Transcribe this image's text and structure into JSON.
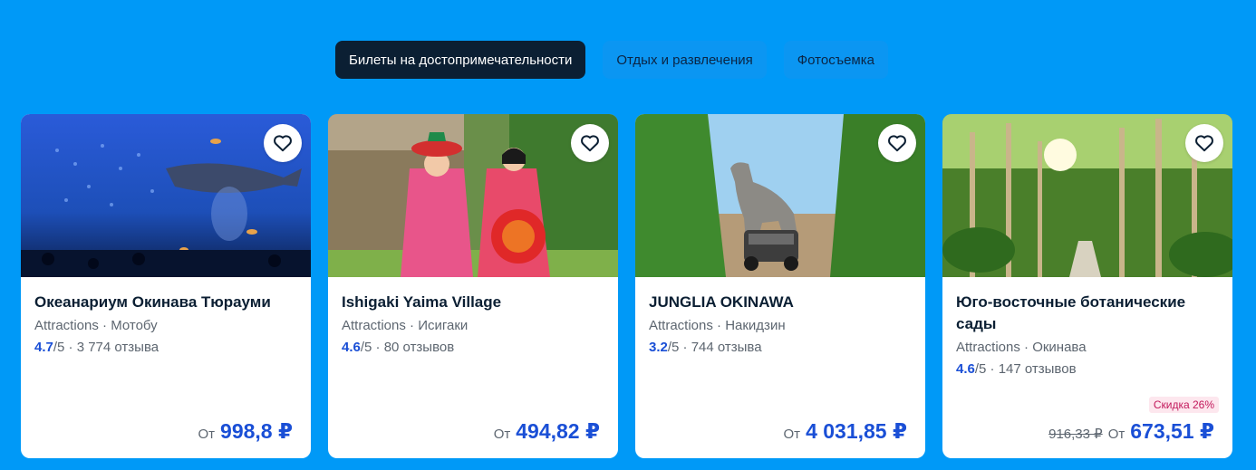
{
  "tabs": [
    {
      "label": "Билеты на достопримечательности",
      "active": true
    },
    {
      "label": "Отдых и развлечения",
      "active": false
    },
    {
      "label": "Фотосъемка",
      "active": false
    }
  ],
  "cards": [
    {
      "title": "Океанариум Окинава Тюрауми",
      "subtitle": "Attractions · Мотобу",
      "score": "4.7",
      "rating_rest": "/5 · 3 774 отзыва",
      "price_prefix": "От",
      "price": "998,8 ₽",
      "image": "aquarium-whale-shark"
    },
    {
      "title": "Ishigaki Yaima Village",
      "subtitle": "Attractions · Исигаки",
      "score": "4.6",
      "rating_rest": "/5 · 80 отзывов",
      "price_prefix": "От",
      "price": "494,82 ₽",
      "image": "women-in-kimono"
    },
    {
      "title": "JUNGLIA OKINAWA",
      "subtitle": "Attractions · Накидзин",
      "score": "3.2",
      "rating_rest": "/5 · 744 отзыва",
      "price_prefix": "От",
      "price": "4 031,85 ₽",
      "image": "dinosaur-jungle-jeep"
    },
    {
      "title": "Юго-восточные ботанические сады",
      "subtitle": "Attractions · Окинава",
      "score": "4.6",
      "rating_rest": "/5 · 147 отзывов",
      "discount": "Скидка 26%",
      "old_price": "916,33 ₽",
      "price_prefix": "От",
      "price": "673,51 ₽",
      "image": "palm-tree-garden"
    }
  ],
  "colors": {
    "background": "#0099f7",
    "active_tab": "#0b1f33",
    "price": "#1a4fd6",
    "discount_bg": "#fde7ee",
    "discount_text": "#c2185b"
  },
  "icons": {
    "favorite": "heart-outline-icon"
  }
}
